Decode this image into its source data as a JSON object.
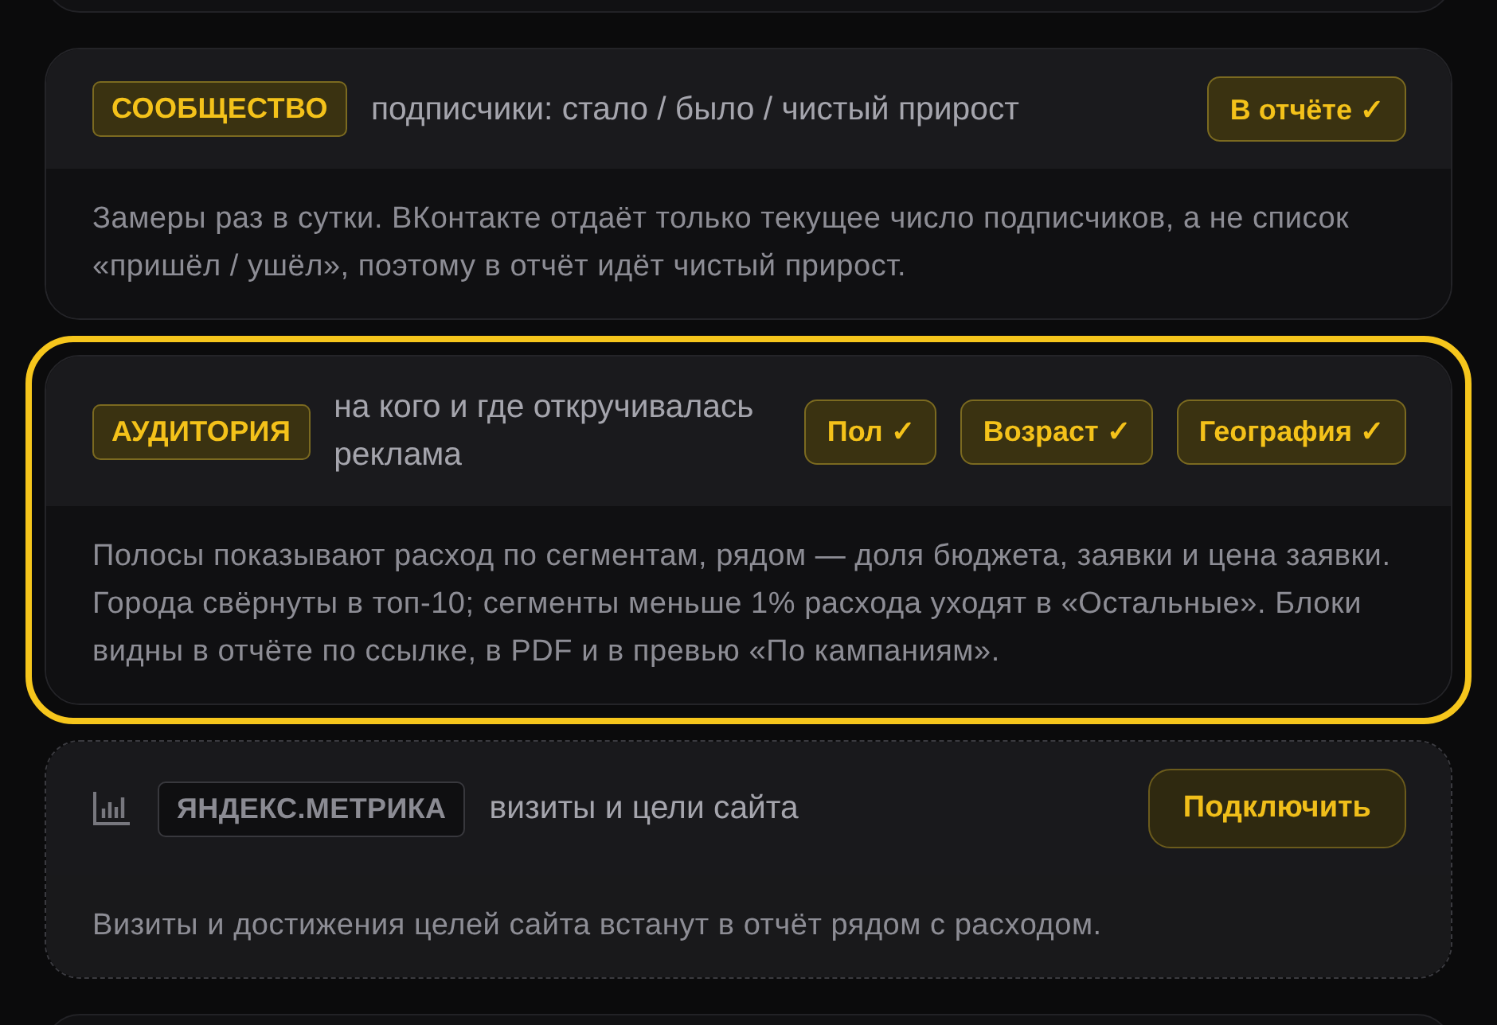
{
  "cards": [
    {
      "badge": "СООБЩЕСТВО",
      "subtitle": "подписчики: стало / было / чистый прирост",
      "connected": true,
      "selected": false,
      "tags": [
        "В отчёте ✓"
      ],
      "note": "Замеры раз в сутки. ВКонтакте отдаёт только текущее число подписчиков, а не список «пришёл / ушёл», поэтому в отчёт идёт чистый прирост."
    },
    {
      "badge": "АУДИТОРИЯ",
      "subtitle": "на кого и где откручивалась реклама",
      "connected": true,
      "selected": true,
      "tags": [
        "Пол ✓",
        "Возраст ✓",
        "География ✓"
      ],
      "note": "Полосы показывают расход по сегментам, рядом — доля бюджета, заявки и цена заявки. Города свёрнуты в топ-10; сегменты меньше 1% расхода уходят в «Остальные». Блоки видны в отчёте по ссылке, в PDF и в превью «По кампаниям»."
    },
    {
      "badge": "ЯНДЕКС.МЕТРИКА",
      "subtitle": "визиты и цели сайта",
      "connected": false,
      "selected": false,
      "action": "Подключить",
      "note": "Визиты и достижения целей сайта встанут в отчёт рядом с расходом."
    }
  ]
}
